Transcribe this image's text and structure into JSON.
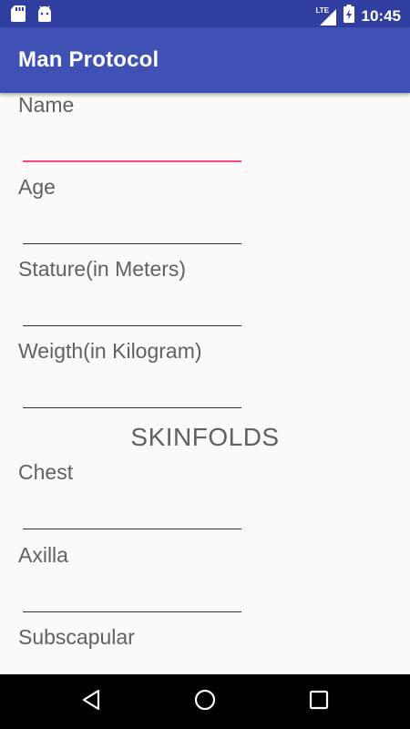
{
  "status_bar": {
    "icons_left": [
      "sd-card-icon",
      "android-icon"
    ],
    "network_type": "LTE",
    "icons_right": [
      "signal-icon",
      "battery-charging-icon"
    ],
    "time": "10:45"
  },
  "app_bar": {
    "title": "Man Protocol"
  },
  "form": {
    "fields": [
      {
        "label": "Name",
        "value": "",
        "focused": true
      },
      {
        "label": "Age",
        "value": ""
      },
      {
        "label": "Stature(in Meters)",
        "value": ""
      },
      {
        "label": "Weigth(in Kilogram)",
        "value": ""
      }
    ],
    "section_title": "SKINFOLDS",
    "skinfold_fields": [
      {
        "label": "Chest",
        "value": ""
      },
      {
        "label": "Axilla",
        "value": ""
      },
      {
        "label": "Subscapular",
        "value": ""
      }
    ]
  },
  "nav_bar": {
    "buttons": [
      "back-icon",
      "home-icon",
      "recents-icon"
    ]
  },
  "colors": {
    "status_bar": "#303f9f",
    "app_bar": "#3f51b5",
    "accent": "#ff4081",
    "background": "#fafafa"
  }
}
